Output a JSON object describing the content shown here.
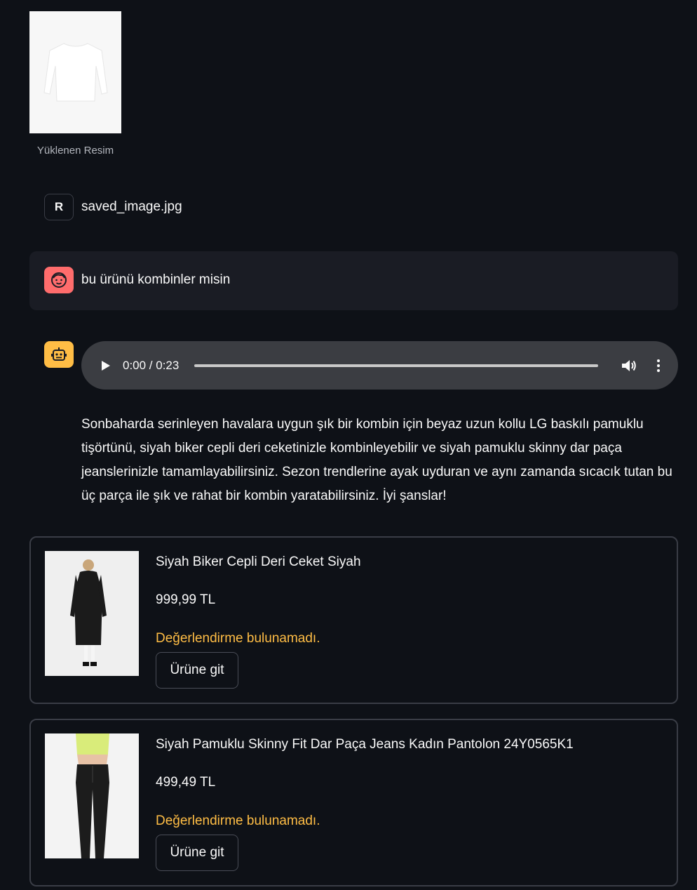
{
  "uploaded": {
    "caption": "Yüklenen Resim",
    "image": "white-long-sleeve-shirt"
  },
  "messages": [
    {
      "role": "R",
      "avatar_label": "R",
      "text": "saved_image.jpg"
    },
    {
      "role": "user",
      "avatar_icon": "smiley-face-icon",
      "text": "bu ürünü kombinler misin"
    },
    {
      "role": "assistant",
      "avatar_icon": "robot-icon"
    }
  ],
  "audio": {
    "time": "0:00 / 0:23",
    "progress": 0.0
  },
  "answer": "Sonbaharda serinleyen havalara uygun şık bir kombin için beyaz uzun kollu LG baskılı pamuklu tişörtünü, siyah biker cepli deri ceketinizle kombinleyebilir ve siyah pamuklu skinny dar paça jeanslerinizle tamamlayabilirsiniz. Sezon trendlerine ayak uyduran ve aynı zamanda sıcacık tutan bu üç parça ile şık ve rahat bir kombin yaratabilirsiniz. İyi şanslar!",
  "products": [
    {
      "title": "Siyah Biker Cepli Deri Ceket Siyah",
      "price": "999,99 TL",
      "rating": "Değerlendirme bulunamadı.",
      "button": "Ürüne git",
      "image": "black-leather-coat"
    },
    {
      "title": "Siyah Pamuklu Skinny Fit Dar Paça Jeans Kadın Pantolon 24Y0565K1",
      "price": "499,49 TL",
      "rating": "Değerlendirme bulunamadı.",
      "button": "Ürüne git",
      "image": "black-skinny-jeans"
    }
  ],
  "colors": {
    "background": "#0e1117",
    "user_avatar": "#ff6c6c",
    "bot_avatar": "#ffbd45",
    "rating_text": "#ffbd45"
  }
}
